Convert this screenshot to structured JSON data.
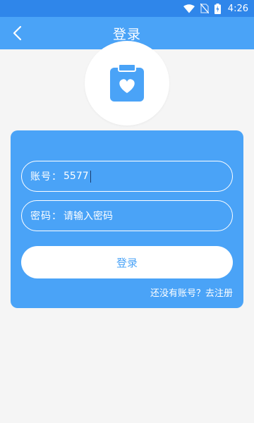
{
  "status_bar": {
    "time": "4:26",
    "icons": [
      "wifi-icon",
      "no-sim-icon",
      "battery-charging-icon"
    ]
  },
  "header": {
    "title": "登录",
    "back_icon": "chevron-left-icon"
  },
  "logo": {
    "icon": "clipboard-heart-icon"
  },
  "form": {
    "account": {
      "label": "账号：",
      "value": "5577"
    },
    "password": {
      "label": "密码：",
      "placeholder": "请输入密码"
    },
    "login_button": "登录",
    "register_link": "还没有账号？去注册"
  },
  "colors": {
    "primary": "#4aa3f7",
    "status_bar": "#2f86ea",
    "background": "#f5f5f5",
    "white": "#ffffff"
  }
}
